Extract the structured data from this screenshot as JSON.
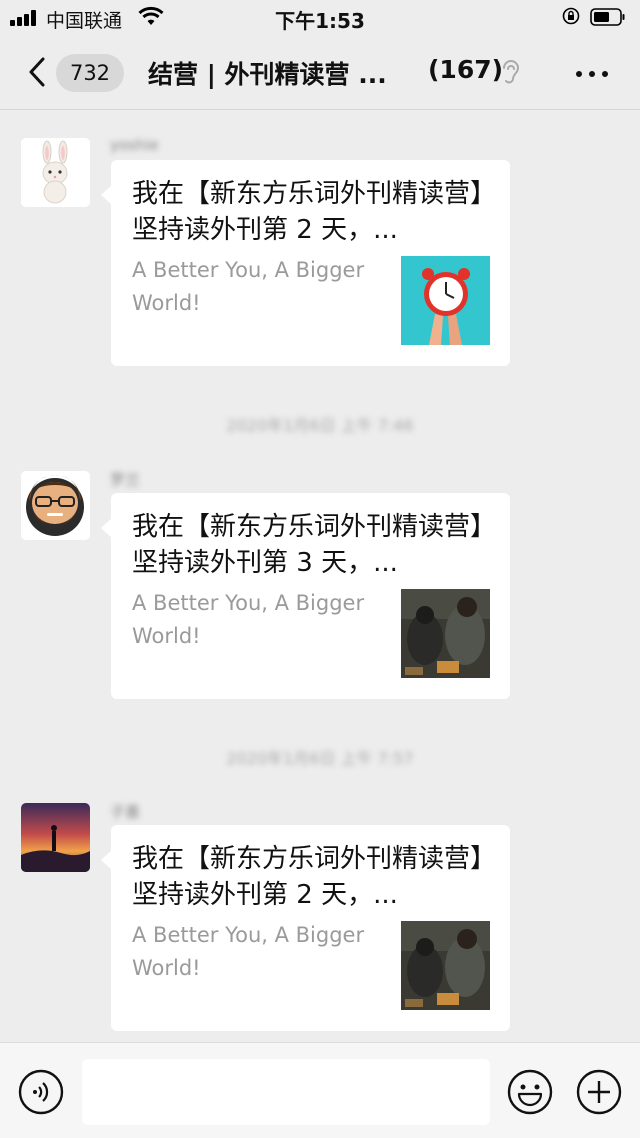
{
  "status_bar": {
    "carrier": "中国联通",
    "time": "下午1:53"
  },
  "nav": {
    "unread_count": "732",
    "title": "结营 | 外刊精读营 ...",
    "member_count": "(167)"
  },
  "messages": [
    {
      "sender": "yoshie",
      "title": "我在【新东方乐词外刊精读营】坚持读外刊第 2 天，...",
      "desc": "A Better You, A Bigger World!",
      "avatar_icon": "rabbit-avatar",
      "thumb_icon": "alarm-clock-image"
    },
    {
      "sender": "罗兰",
      "title": "我在【新东方乐词外刊精读营】坚持读外刊第 3 天，...",
      "desc": "A Better You, A Bigger World!",
      "avatar_icon": "bearded-man-avatar",
      "thumb_icon": "homeless-people-image"
    },
    {
      "sender": "子墨",
      "title": "我在【新东方乐词外刊精读营】坚持读外刊第 2 天，...",
      "desc": "A Better You, A Bigger World!",
      "avatar_icon": "sunset-silhouette-avatar",
      "thumb_icon": "homeless-people-image"
    }
  ],
  "timestamps": [
    "2020年1月6日 上午 7:46",
    "2020年1月6日 上午 7:57"
  ],
  "input": {
    "placeholder": ""
  },
  "colors": {
    "background": "#ededed",
    "bubble": "#ffffff",
    "secondary_text": "#9a9a9a"
  }
}
